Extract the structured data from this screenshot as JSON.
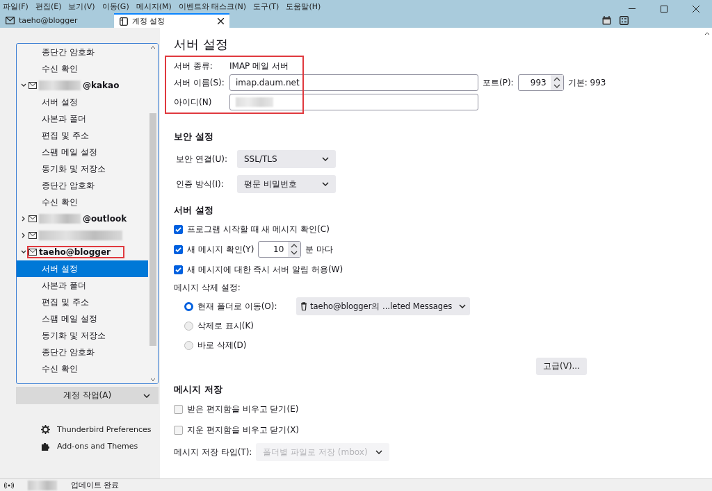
{
  "menu_bar": [
    "파일(F)",
    "편집(E)",
    "보기(V)",
    "이동(G)",
    "메시지(M)",
    "이벤트와 태스크(N)",
    "도구(T)",
    "도움말(H)"
  ],
  "tabs": [
    {
      "label": "taeho@blogger",
      "kind": "mail",
      "selected": false
    },
    {
      "label": "계정 설정",
      "kind": "settings",
      "selected": true
    }
  ],
  "sidebar": {
    "tree": [
      {
        "kind": "page",
        "label": "종단간 암호화",
        "selected": false
      },
      {
        "kind": "page",
        "label": "수신 확인",
        "selected": false
      },
      {
        "kind": "account",
        "label": "@kakao",
        "masked": true,
        "expanded": true,
        "highlighted": false,
        "children": [
          {
            "kind": "page",
            "label": "서버 설정",
            "selected": false
          },
          {
            "kind": "page",
            "label": "사본과 폴더",
            "selected": false
          },
          {
            "kind": "page",
            "label": "편집 및 주소",
            "selected": false
          },
          {
            "kind": "page",
            "label": "스팸 메일 설정",
            "selected": false
          },
          {
            "kind": "page",
            "label": "동기화 및 저장소",
            "selected": false
          },
          {
            "kind": "page",
            "label": "종단간 암호화",
            "selected": false
          },
          {
            "kind": "page",
            "label": "수신 확인",
            "selected": false
          }
        ]
      },
      {
        "kind": "account",
        "label": "@outlook",
        "masked": true,
        "expanded": false,
        "highlighted": false
      },
      {
        "kind": "account",
        "masked": true,
        "expanded": false,
        "highlighted": false
      },
      {
        "kind": "account",
        "label": "taeho@blogger",
        "expanded": true,
        "highlighted": true,
        "children": [
          {
            "kind": "page",
            "label": "서버 설정",
            "selected": true
          },
          {
            "kind": "page",
            "label": "사본과 폴더",
            "selected": false
          },
          {
            "kind": "page",
            "label": "편집 및 주소",
            "selected": false
          },
          {
            "kind": "page",
            "label": "스팸 메일 설정",
            "selected": false
          },
          {
            "kind": "page",
            "label": "동기화 및 저장소",
            "selected": false
          },
          {
            "kind": "page",
            "label": "종단간 암호화",
            "selected": false
          },
          {
            "kind": "page",
            "label": "수신 확인",
            "selected": false
          }
        ]
      }
    ],
    "account_actions": "계정 작업(A)",
    "links": [
      {
        "label": "Thunderbird Preferences",
        "kind": "gear"
      },
      {
        "label": "Add-ons and Themes",
        "kind": "puzzle"
      }
    ]
  },
  "content": {
    "title": "서버 설정",
    "identity": {
      "highlighted": true,
      "server_type_label": "서버 종류:",
      "server_type": "IMAP 메일 서버",
      "server_name_label": "서버 이름(S):",
      "server_name": "imap.daum.net",
      "user_id_label": "아이디(N)",
      "user_id_masked": true
    },
    "port": {
      "label": "포트(P):",
      "value": "993",
      "default": "기본: 993"
    },
    "security": {
      "heading": "보안 설정",
      "fields": [
        {
          "label": "보안 연결(U):",
          "value": "SSL/TLS"
        },
        {
          "label": "인증 방식(I):",
          "value": "평문 비밀번호"
        }
      ]
    },
    "server": {
      "heading": "서버 설정",
      "options": [
        {
          "kind": "checkbox",
          "label": "프로그램 시작할 때 새 메시지 확인(C)",
          "checked": true
        },
        {
          "kind": "interval",
          "label": "새 메시지 확인(Y)",
          "checked": true,
          "value": "10",
          "unit": "분 마다"
        },
        {
          "kind": "checkbox",
          "label": "새 메시지에 대한 즉시 서버 알림 허용(W)",
          "checked": true
        }
      ],
      "delete_label": "메시지 삭제 설정:",
      "delete_options": [
        {
          "label": "현재 폴더로 이동(O):",
          "selected": true,
          "folder": "taeho@blogger의 ...leted Messages"
        },
        {
          "label": "삭제로 표시(K)",
          "selected": false
        },
        {
          "label": "바로 삭제(D)",
          "selected": false
        }
      ],
      "advanced_button": "고급(V)..."
    },
    "storage": {
      "heading": "메시지 저장",
      "options": [
        {
          "label": "받은 편지함을 비우고 닫기(E)",
          "checked": false
        },
        {
          "label": "지운 편지함을 비우고 닫기(X)",
          "checked": false
        }
      ],
      "type_label": "메시지 저장 타입(T):",
      "type_value": "폴더별 파일로 저장 (mbox)",
      "type_disabled": true
    }
  },
  "status_bar": {
    "text": "업데이트 완료"
  }
}
